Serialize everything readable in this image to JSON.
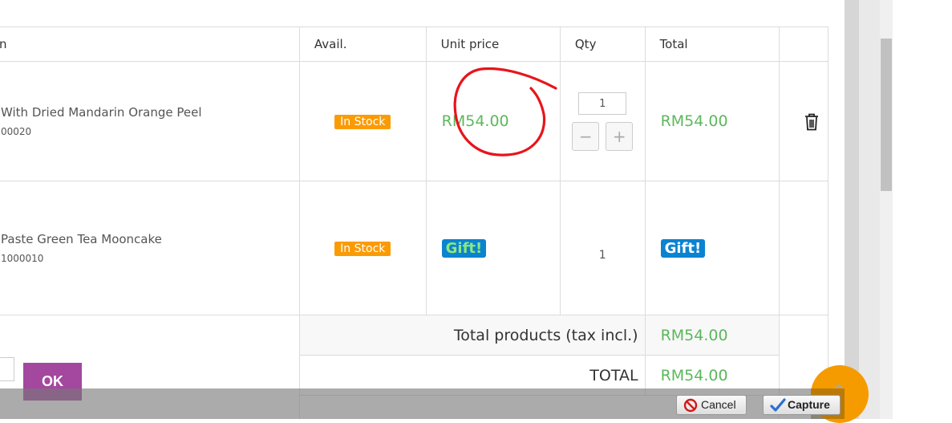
{
  "table": {
    "headers": {
      "product": "n",
      "avail": "Avail.",
      "unit_price": "Unit price",
      "qty": "Qty",
      "total": "Total"
    },
    "rows": [
      {
        "name": "With Dried Mandarin Orange Peel",
        "reference": "00020",
        "availability": "In Stock",
        "unit_price": "RM54.00",
        "qty": "1",
        "total": "RM54.00",
        "qty_minus": "−",
        "qty_plus": "+"
      },
      {
        "name": "Paste Green Tea Mooncake",
        "reference": "1000010",
        "availability": "In Stock",
        "unit_price": "Gift!",
        "qty": "1",
        "total": "Gift!"
      }
    ]
  },
  "summary": {
    "total_products_label": "Total products (tax incl.)",
    "total_products_value": "RM54.00",
    "total_label": "TOTAL",
    "total_value": "RM54.00"
  },
  "voucher": {
    "ok_label": "OK"
  },
  "capture_bar": {
    "cancel_label": "Cancel",
    "capture_label": "Capture"
  },
  "colors": {
    "price_green": "#5cb85c",
    "stock_orange": "#fb9b04",
    "gift_blue": "#0a83d1",
    "ok_purple": "#a3479f",
    "annotation_red": "#e8141b"
  }
}
